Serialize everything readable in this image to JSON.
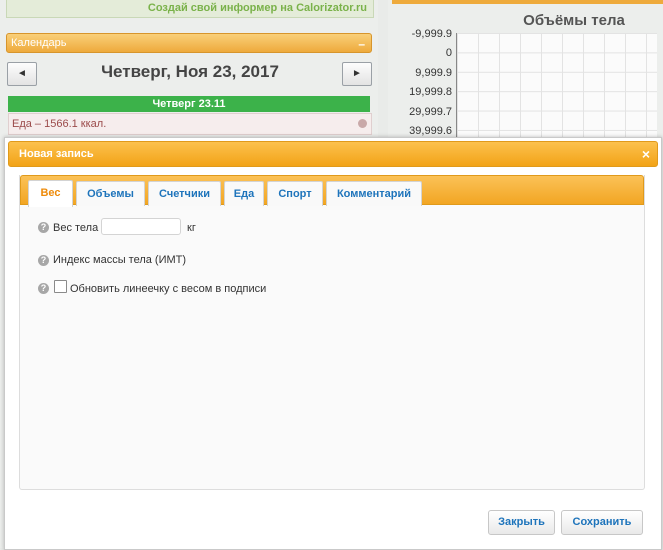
{
  "background": {
    "informer_text": "Создай свой информер на Calorizator.ru",
    "calendar": {
      "header_title": "Календарь",
      "collapse_symbol": "–",
      "prev_symbol": "◄",
      "next_symbol": "►",
      "date_title": "Четверг, Ноя 23, 2017",
      "day_label": "Четверг 23.11",
      "food_line": "Еда – 1566.1 ккал."
    },
    "chart": {
      "title": "Объёмы тела",
      "y_ticks": [
        "-9,999.9",
        "0",
        "9,999.9",
        "19,999.8",
        "29,999.7",
        "39,999.6"
      ]
    }
  },
  "modal": {
    "title": "Новая запись",
    "close_symbol": "×",
    "tabs": [
      {
        "label": "Вес",
        "active": true
      },
      {
        "label": "Объемы",
        "active": false
      },
      {
        "label": "Счетчики",
        "active": false
      },
      {
        "label": "Еда",
        "active": false
      },
      {
        "label": "Спорт",
        "active": false
      },
      {
        "label": "Комментарий",
        "active": false
      }
    ],
    "fields": {
      "help_symbol": "?",
      "weight_label": "Вес тела",
      "weight_value": "",
      "weight_unit": "кг",
      "bmi_label": "Индекс массы тела (ИМТ)",
      "update_checkbox_label": "Обновить линеечку с весом в подписи",
      "update_checked": false
    },
    "buttons": {
      "close": "Закрыть",
      "save": "Сохранить"
    }
  },
  "colors": {
    "accent_orange": "#f2a317",
    "link_blue": "#1e74bb",
    "active_tab_orange": "#ee8b0b",
    "day_green": "#3cb24a"
  }
}
